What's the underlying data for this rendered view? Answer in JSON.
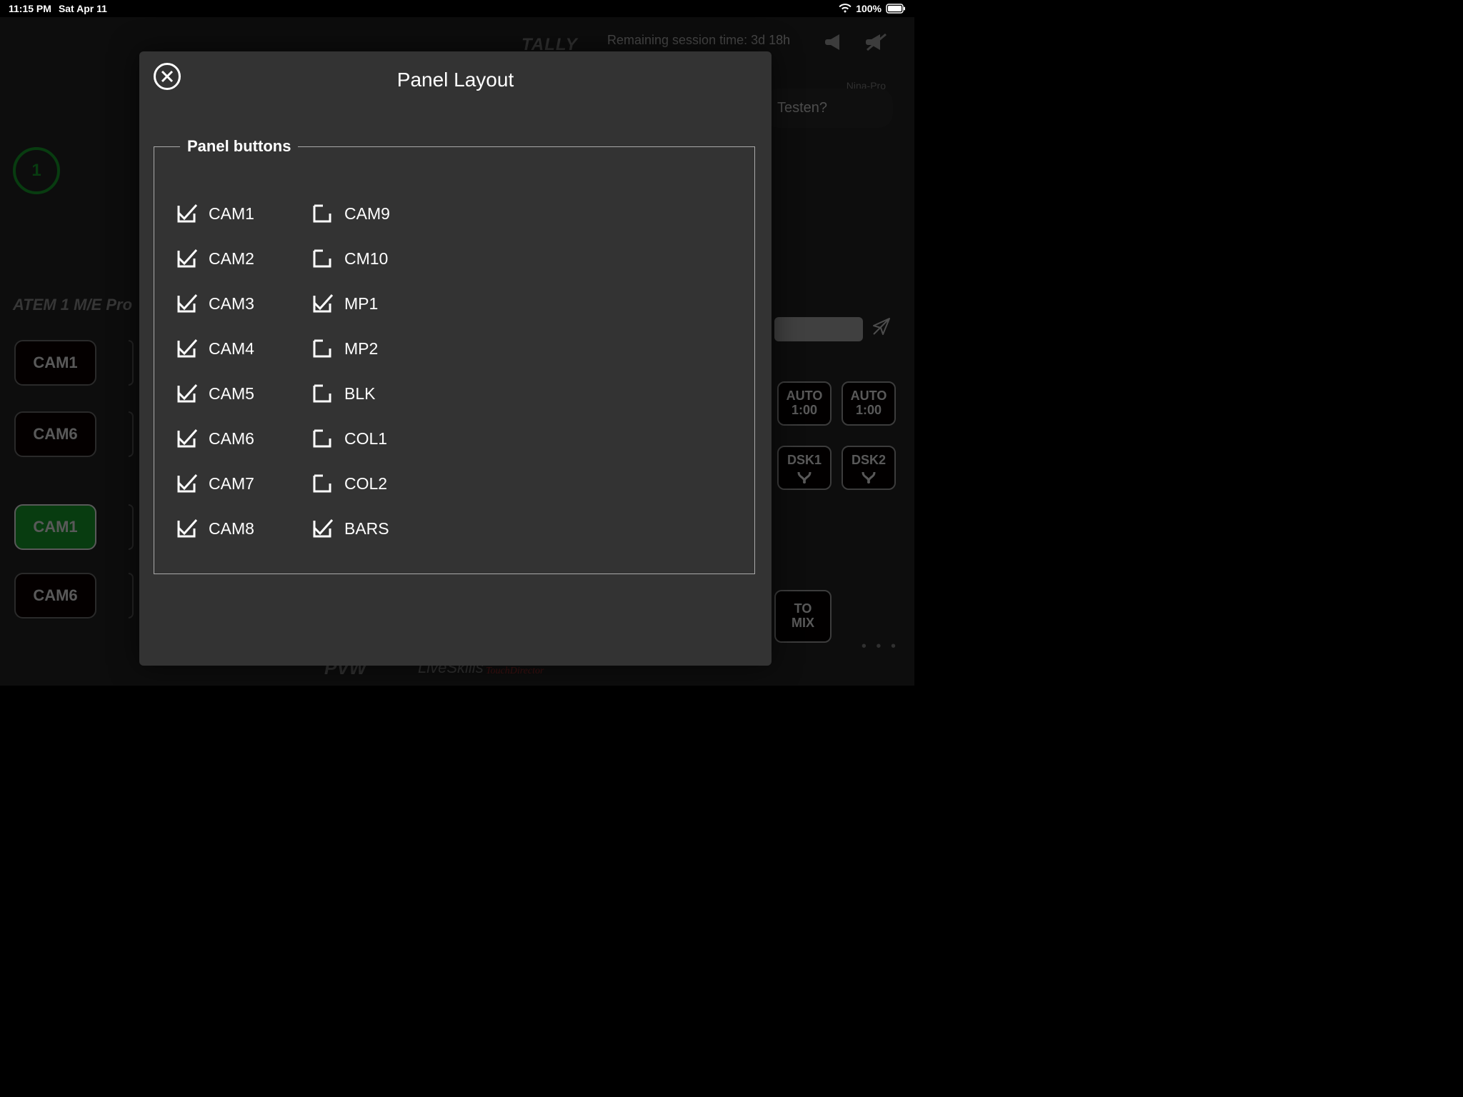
{
  "status": {
    "time": "11:15 PM",
    "date": "Sat Apr 11",
    "battery": "100%"
  },
  "bg": {
    "tally": "TALLY",
    "tally_num": "1",
    "session": "Remaining session time:  3d 18h",
    "chat_name": "Nina-Pro",
    "chat_text": "Testen?",
    "device": "ATEM 1 M/E Pro",
    "btns": {
      "cam1a": "CAM1",
      "cam6a": "CAM6",
      "cam1b": "CAM1",
      "cam6b": "CAM6"
    },
    "pvw": "PVW",
    "liveskills": "LiveSkills",
    "touchdirector": "TouchDirector",
    "auto": {
      "l1": "AUTO",
      "l2": "1:00"
    },
    "dsk1": "DSK1",
    "dsk2": "DSK2",
    "to": "TO",
    "mix": "MIX"
  },
  "modal": {
    "title": "Panel Layout",
    "legend": "Panel buttons",
    "items": [
      {
        "label": "CAM1",
        "checked": true
      },
      {
        "label": "CAM9",
        "checked": false
      },
      {
        "label": "CAM2",
        "checked": true
      },
      {
        "label": "CM10",
        "checked": false
      },
      {
        "label": "CAM3",
        "checked": true
      },
      {
        "label": "MP1",
        "checked": true
      },
      {
        "label": "CAM4",
        "checked": true
      },
      {
        "label": "MP2",
        "checked": false
      },
      {
        "label": "CAM5",
        "checked": true
      },
      {
        "label": "BLK",
        "checked": false
      },
      {
        "label": "CAM6",
        "checked": true
      },
      {
        "label": "COL1",
        "checked": false
      },
      {
        "label": "CAM7",
        "checked": true
      },
      {
        "label": "COL2",
        "checked": false
      },
      {
        "label": "CAM8",
        "checked": true
      },
      {
        "label": "BARS",
        "checked": true
      }
    ]
  }
}
